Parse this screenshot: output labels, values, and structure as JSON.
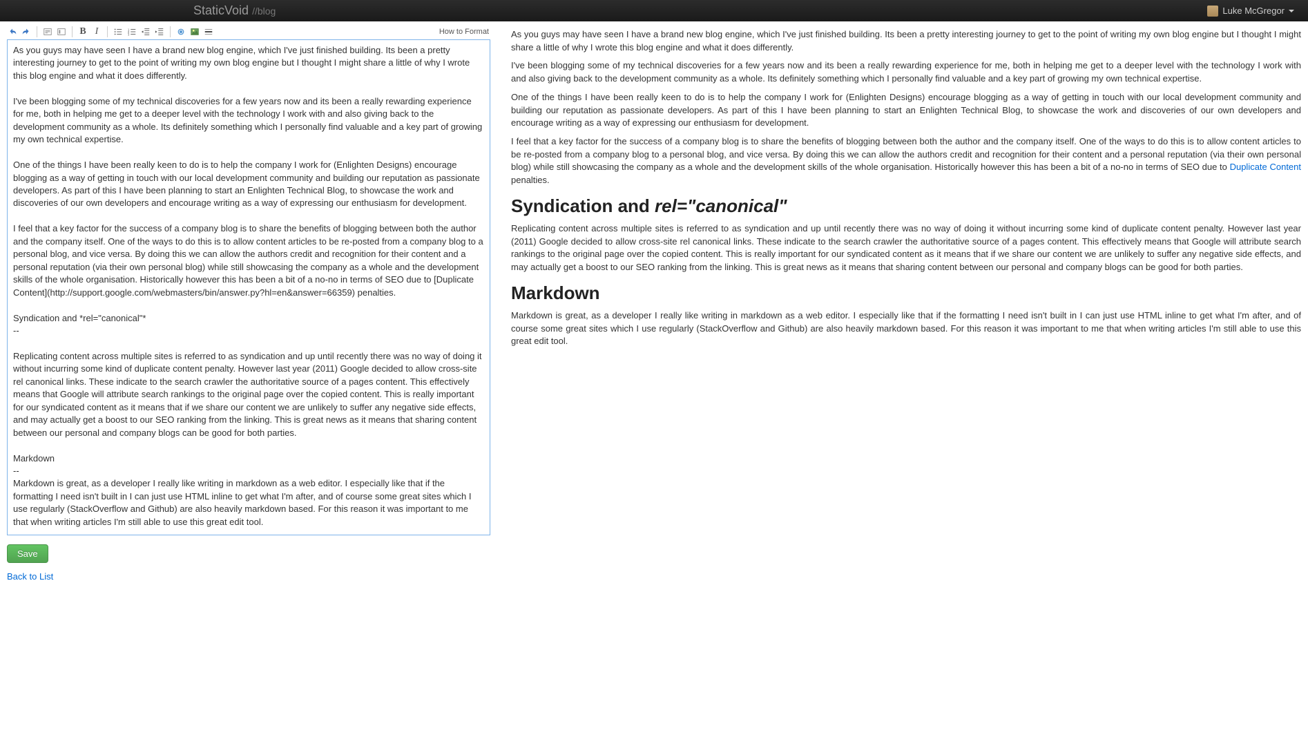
{
  "navbar": {
    "brand_main": "StaticVoid",
    "brand_sub": "//blog",
    "user": "Luke McGregor"
  },
  "toolbar": {
    "format_link": "How to Format"
  },
  "editor": {
    "value": "As you guys may have seen I have a brand new blog engine, which I've just finished building. Its been a pretty interesting journey to get to the point of writing my own blog engine but I thought I might share a little of why I wrote this blog engine and what it does differently.\n\nI've been blogging some of my technical discoveries for a few years now and its been a really rewarding experience for me, both in helping me get to a deeper level with the technology I work with and also giving back to the development community as a whole. Its definitely something which I personally find valuable and a key part of growing my own technical expertise.\n\nOne of the things I have been really keen to do is to help the company I work for (Enlighten Designs) encourage blogging as a way of getting in touch with our local development community and building our reputation as passionate developers. As part of this I have been planning to start an Enlighten Technical Blog, to showcase the work and discoveries of our own developers and encourage writing as a way of expressing our enthusiasm for development.\n\nI feel that a key factor for the success of a company blog is to share the benefits of blogging between both the author and the company itself. One of the ways to do this is to allow content articles to be re-posted from a company blog to a personal blog, and vice versa. By doing this we can allow the authors credit and recognition for their content and a personal reputation (via their own personal blog) while still showcasing the company as a whole and the development skills of the whole organisation. Historically however this has been a bit of a no-no in terms of SEO due to [Duplicate Content](http://support.google.com/webmasters/bin/answer.py?hl=en&answer=66359) penalties.\n\nSyndication and *rel=\"canonical\"*\n--\n\nReplicating content across multiple sites is referred to as syndication and up until recently there was no way of doing it without incurring some kind of duplicate content penalty. However last year (2011) Google decided to allow cross-site rel canonical links. These indicate to the search crawler the authoritative source of a pages content. This effectively means that Google will attribute search rankings to the original page over the copied content. This is really important for our syndicated content as it means that if we share our content we are unlikely to suffer any negative side effects, and may actually get a boost to our SEO ranking from the linking. This is great news as it means that sharing content between our personal and company blogs can be good for both parties.\n\nMarkdown\n--\nMarkdown is great, as a developer I really like writing in markdown as a web editor. I especially like that if the formatting I need isn't built in I can just use HTML inline to get what I'm after, and of course some great sites which I use regularly (StackOverflow and Github) are also heavily markdown based. For this reason it was important to me that when writing articles I'm still able to use this great edit tool."
  },
  "actions": {
    "save": "Save",
    "back": "Back to List"
  },
  "preview": {
    "p1": "As you guys may have seen I have a brand new blog engine, which I've just finished building. Its been a pretty interesting journey to get to the point of writing my own blog engine but I thought I might share a little of why I wrote this blog engine and what it does differently.",
    "p2": "I've been blogging some of my technical discoveries for a few years now and its been a really rewarding experience for me, both in helping me get to a deeper level with the technology I work with and also giving back to the development community as a whole. Its definitely something which I personally find valuable and a key part of growing my own technical expertise.",
    "p3": "One of the things I have been really keen to do is to help the company I work for (Enlighten Designs) encourage blogging as a way of getting in touch with our local development community and building our reputation as passionate developers. As part of this I have been planning to start an Enlighten Technical Blog, to showcase the work and discoveries of our own developers and encourage writing as a way of expressing our enthusiasm for development.",
    "p4a": "I feel that a key factor for the success of a company blog is to share the benefits of blogging between both the author and the company itself. One of the ways to do this is to allow content articles to be re-posted from a company blog to a personal blog, and vice versa. By doing this we can allow the authors credit and recognition for their content and a personal reputation (via their own personal blog) while still showcasing the company as a whole and the development skills of the whole organisation. Historically however this has been a bit of a no-no in terms of SEO due to ",
    "p4_link": "Duplicate Content",
    "p4b": " penalties.",
    "h1a": "Syndication and ",
    "h1b": "rel=\"canonical\"",
    "p5": "Replicating content across multiple sites is referred to as syndication and up until recently there was no way of doing it without incurring some kind of duplicate content penalty. However last year (2011) Google decided to allow cross-site rel canonical links. These indicate to the search crawler the authoritative source of a pages content. This effectively means that Google will attribute search rankings to the original page over the copied content. This is really important for our syndicated content as it means that if we share our content we are unlikely to suffer any negative side effects, and may actually get a boost to our SEO ranking from the linking. This is great news as it means that sharing content between our personal and company blogs can be good for both parties.",
    "h2": "Markdown",
    "p6": "Markdown is great, as a developer I really like writing in markdown as a web editor. I especially like that if the formatting I need isn't built in I can just use HTML inline to get what I'm after, and of course some great sites which I use regularly (StackOverflow and Github) are also heavily markdown based. For this reason it was important to me that when writing articles I'm still able to use this great edit tool."
  }
}
